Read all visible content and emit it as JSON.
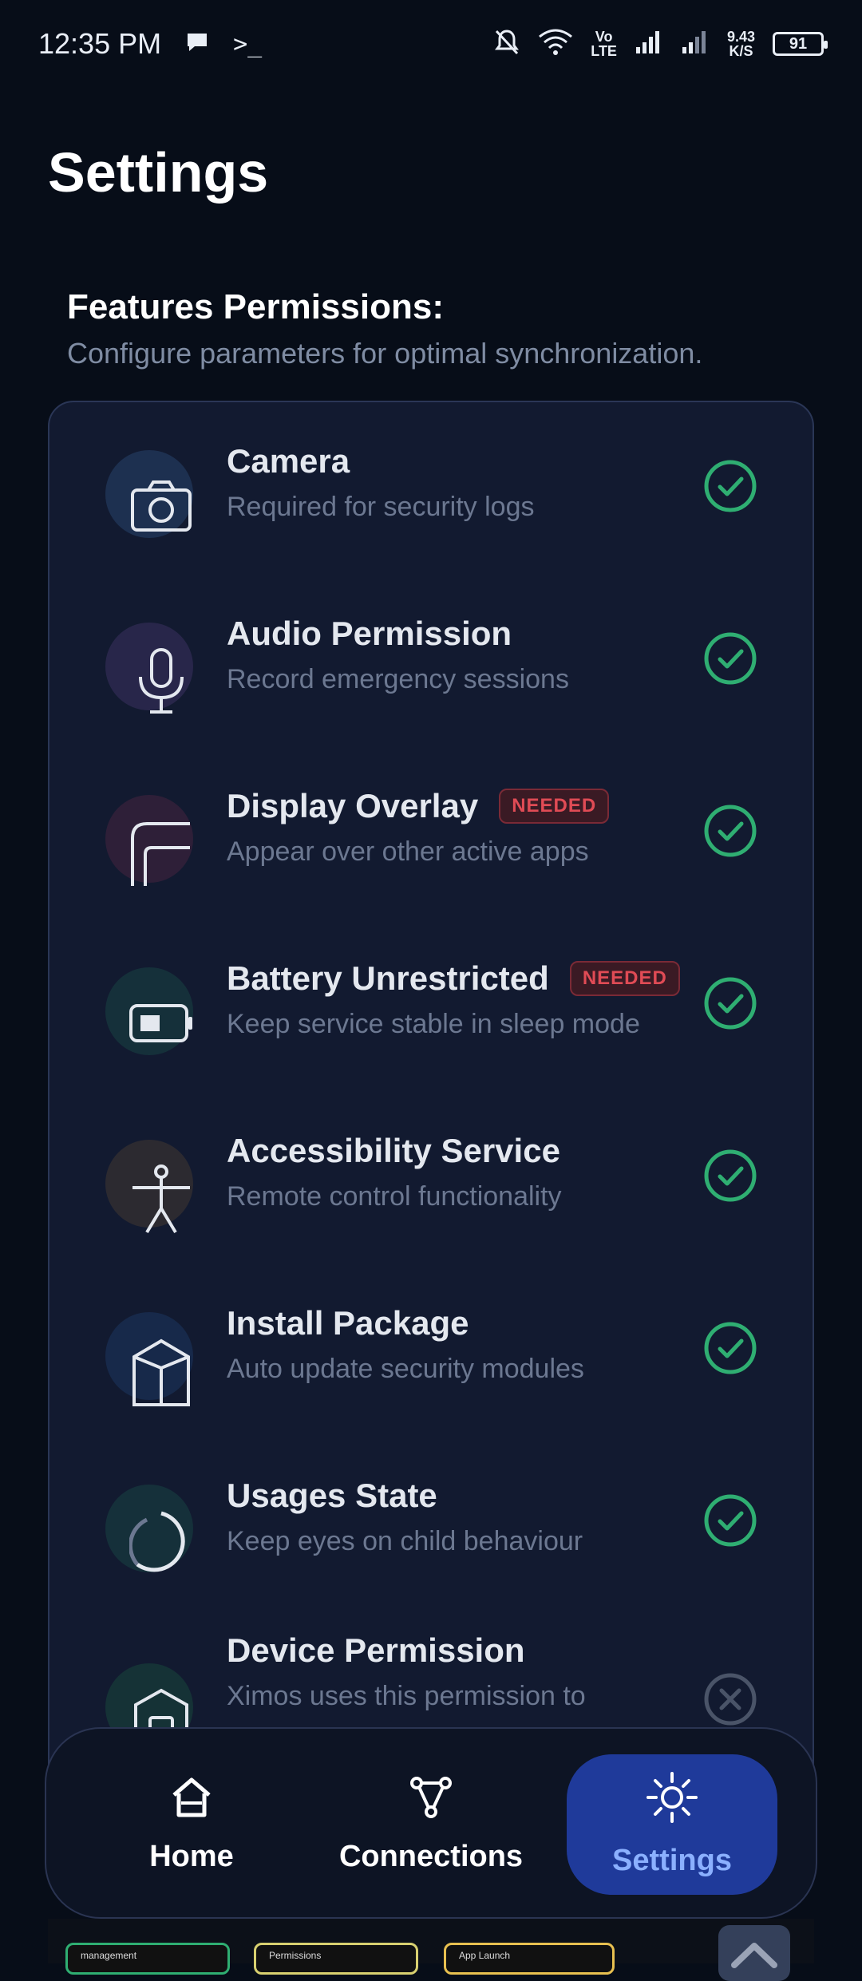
{
  "status_bar": {
    "time": "12:35 PM",
    "speed_value": "9.43",
    "speed_unit": "K/S",
    "volte_top": "Vo",
    "volte_bottom": "LTE",
    "battery": "91"
  },
  "page": {
    "title": "Settings",
    "section_title": "Features Permissions:",
    "section_subtitle": "Configure parameters for optimal synchronization."
  },
  "permissions": [
    {
      "name": "Camera",
      "desc": "Required for security logs",
      "badge": "",
      "granted": true,
      "icon": "camera-icon",
      "icon_bg": "#1d3050"
    },
    {
      "name": "Audio Permission",
      "desc": "Record emergency sessions",
      "badge": "",
      "granted": true,
      "icon": "microphone-icon",
      "icon_bg": "#28264a"
    },
    {
      "name": "Display Overlay",
      "desc": "Appear over other active apps",
      "badge": "NEEDED",
      "granted": true,
      "icon": "overlay-icon",
      "icon_bg": "#2e1f38"
    },
    {
      "name": "Battery Unrestricted",
      "desc": "Keep service stable in sleep mode",
      "badge": "NEEDED",
      "granted": true,
      "icon": "battery-icon",
      "icon_bg": "#15303a"
    },
    {
      "name": "Accessibility Service",
      "desc": "Remote control functionality",
      "badge": "",
      "granted": true,
      "icon": "accessibility-icon",
      "icon_bg": "#2c2a30"
    },
    {
      "name": "Install Package",
      "desc": "Auto update security modules",
      "badge": "",
      "granted": true,
      "icon": "package-icon",
      "icon_bg": "#17294a"
    },
    {
      "name": "Usages State",
      "desc": "Keep eyes on child behaviour",
      "badge": "",
      "granted": true,
      "icon": "usage-icon",
      "icon_bg": "#15303a"
    },
    {
      "name": "Device Permission",
      "desc": "Ximos uses this permission to",
      "badge": "",
      "granted": false,
      "icon": "device-admin-icon",
      "icon_bg": "#153236"
    }
  ],
  "nav": {
    "home": "Home",
    "connections": "Connections",
    "settings": "Settings"
  },
  "peek": {
    "card1": "management",
    "card2": "Permissions",
    "card3": "App Launch"
  },
  "colors": {
    "granted": "#2fae72",
    "denied": "#4a5468",
    "badge_text": "#e04b55",
    "accent": "#1f3a9a"
  }
}
